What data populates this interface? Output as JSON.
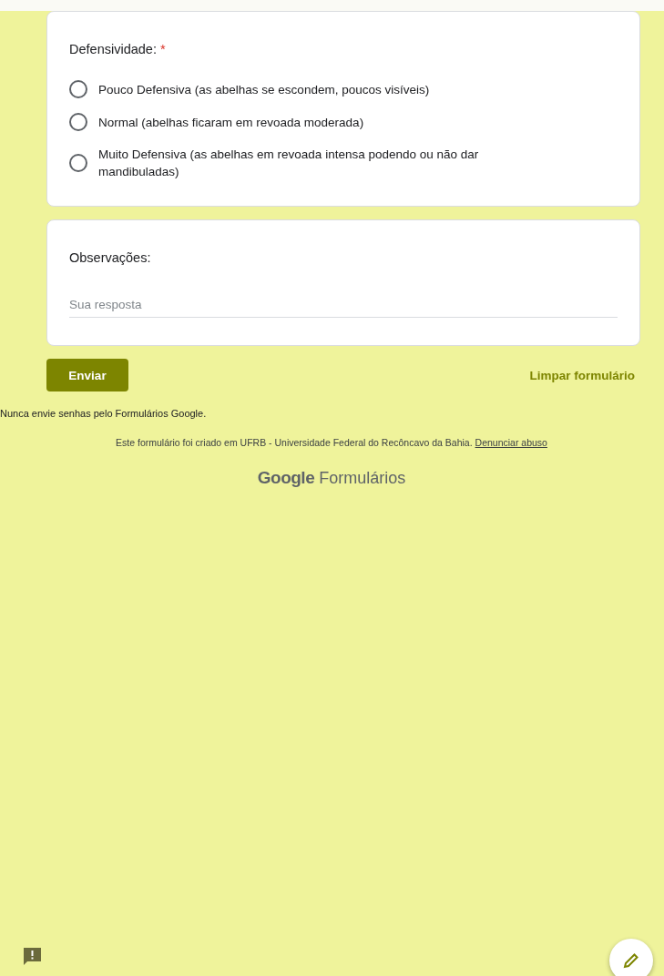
{
  "questions": [
    {
      "kind": "radio",
      "title": "Defensividade:",
      "required_mark": "*",
      "options": [
        {
          "label": "Pouco Defensiva (as abelhas se escondem, poucos visíveis)",
          "selected": false
        },
        {
          "label": "Normal (abelhas ficaram em revoada moderada)",
          "selected": false
        },
        {
          "label": "Muito Defensiva (as abelhas em revoada intensa podendo ou não dar mandibuladas)",
          "selected": false
        }
      ]
    },
    {
      "kind": "text",
      "title": "Observações:",
      "placeholder": "Sua resposta"
    }
  ],
  "submit_button": "Enviar",
  "clear_link": "Limpar formulário",
  "warning": "Nunca envie senhas pelo Formulários Google.",
  "footer": {
    "text": "Este formulário foi criado em UFRB - Universidade Federal do Recôncavo da Bahia.",
    "link": "Denunciar abuso"
  },
  "brand": {
    "google": "Google",
    "product": "Formulários"
  }
}
